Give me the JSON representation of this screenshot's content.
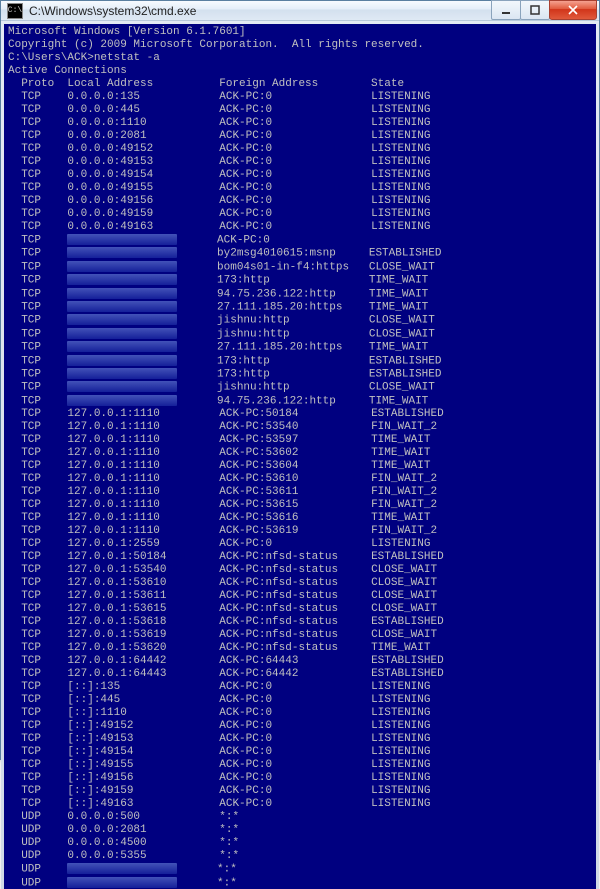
{
  "titlebar": {
    "icon_label": "C:\\",
    "title": "C:\\Windows\\system32\\cmd.exe"
  },
  "win_buttons": {
    "minimize_label": "minimize",
    "maximize_label": "maximize",
    "close_label": "close"
  },
  "console": {
    "line_version": "Microsoft Windows [Version 6.1.7601]",
    "line_copyright": "Copyright (c) 2009 Microsoft Corporation.  All rights reserved.",
    "prompt": "C:\\Users\\ACK>netstat -a",
    "section": "Active Connections",
    "columns": {
      "proto": "Proto",
      "local": "Local Address",
      "foreign": "Foreign Address",
      "state": "State"
    },
    "rows": [
      {
        "proto": "TCP",
        "local": "0.0.0.0:135",
        "foreign": "ACK-PC:0",
        "state": "LISTENING"
      },
      {
        "proto": "TCP",
        "local": "0.0.0.0:445",
        "foreign": "ACK-PC:0",
        "state": "LISTENING"
      },
      {
        "proto": "TCP",
        "local": "0.0.0.0:1110",
        "foreign": "ACK-PC:0",
        "state": "LISTENING"
      },
      {
        "proto": "TCP",
        "local": "0.0.0.0:2081",
        "foreign": "ACK-PC:0",
        "state": "LISTENING"
      },
      {
        "proto": "TCP",
        "local": "0.0.0.0:49152",
        "foreign": "ACK-PC:0",
        "state": "LISTENING"
      },
      {
        "proto": "TCP",
        "local": "0.0.0.0:49153",
        "foreign": "ACK-PC:0",
        "state": "LISTENING"
      },
      {
        "proto": "TCP",
        "local": "0.0.0.0:49154",
        "foreign": "ACK-PC:0",
        "state": "LISTENING"
      },
      {
        "proto": "TCP",
        "local": "0.0.0.0:49155",
        "foreign": "ACK-PC:0",
        "state": "LISTENING"
      },
      {
        "proto": "TCP",
        "local": "0.0.0.0:49156",
        "foreign": "ACK-PC:0",
        "state": "LISTENING"
      },
      {
        "proto": "TCP",
        "local": "0.0.0.0:49159",
        "foreign": "ACK-PC:0",
        "state": "LISTENING"
      },
      {
        "proto": "TCP",
        "local": "0.0.0.0:49163",
        "foreign": "ACK-PC:0",
        "state": "LISTENING"
      },
      {
        "proto": "TCP",
        "local": "[redacted]",
        "foreign": "ACK-PC:0",
        "state": ""
      },
      {
        "proto": "TCP",
        "local": "[redacted]",
        "foreign": "by2msg4010615:msnp",
        "state": "ESTABLISHED"
      },
      {
        "proto": "TCP",
        "local": "[redacted]",
        "foreign": "bom04s01-in-f4:https",
        "state": "CLOSE_WAIT"
      },
      {
        "proto": "TCP",
        "local": "[redacted]",
        "foreign": "173:http",
        "state": "TIME_WAIT"
      },
      {
        "proto": "TCP",
        "local": "[redacted]",
        "foreign": "94.75.236.122:http",
        "state": "TIME_WAIT"
      },
      {
        "proto": "TCP",
        "local": "[redacted]",
        "foreign": "27.111.185.20:https",
        "state": "TIME_WAIT"
      },
      {
        "proto": "TCP",
        "local": "[redacted]",
        "foreign": "jishnu:http",
        "state": "CLOSE_WAIT"
      },
      {
        "proto": "TCP",
        "local": "[redacted]",
        "foreign": "jishnu:http",
        "state": "CLOSE_WAIT"
      },
      {
        "proto": "TCP",
        "local": "[redacted]",
        "foreign": "27.111.185.20:https",
        "state": "TIME_WAIT"
      },
      {
        "proto": "TCP",
        "local": "[redacted]",
        "foreign": "173:http",
        "state": "ESTABLISHED"
      },
      {
        "proto": "TCP",
        "local": "[redacted]",
        "foreign": "173:http",
        "state": "ESTABLISHED"
      },
      {
        "proto": "TCP",
        "local": "[redacted]",
        "foreign": "jishnu:http",
        "state": "CLOSE_WAIT"
      },
      {
        "proto": "TCP",
        "local": "[redacted]",
        "foreign": "94.75.236.122:http",
        "state": "TIME_WAIT"
      },
      {
        "proto": "TCP",
        "local": "127.0.0.1:1110",
        "foreign": "ACK-PC:50184",
        "state": "ESTABLISHED"
      },
      {
        "proto": "TCP",
        "local": "127.0.0.1:1110",
        "foreign": "ACK-PC:53540",
        "state": "FIN_WAIT_2"
      },
      {
        "proto": "TCP",
        "local": "127.0.0.1:1110",
        "foreign": "ACK-PC:53597",
        "state": "TIME_WAIT"
      },
      {
        "proto": "TCP",
        "local": "127.0.0.1:1110",
        "foreign": "ACK-PC:53602",
        "state": "TIME_WAIT"
      },
      {
        "proto": "TCP",
        "local": "127.0.0.1:1110",
        "foreign": "ACK-PC:53604",
        "state": "TIME_WAIT"
      },
      {
        "proto": "TCP",
        "local": "127.0.0.1:1110",
        "foreign": "ACK-PC:53610",
        "state": "FIN_WAIT_2"
      },
      {
        "proto": "TCP",
        "local": "127.0.0.1:1110",
        "foreign": "ACK-PC:53611",
        "state": "FIN_WAIT_2"
      },
      {
        "proto": "TCP",
        "local": "127.0.0.1:1110",
        "foreign": "ACK-PC:53615",
        "state": "FIN_WAIT_2"
      },
      {
        "proto": "TCP",
        "local": "127.0.0.1:1110",
        "foreign": "ACK-PC:53616",
        "state": "TIME_WAIT"
      },
      {
        "proto": "TCP",
        "local": "127.0.0.1:1110",
        "foreign": "ACK-PC:53619",
        "state": "FIN_WAIT_2"
      },
      {
        "proto": "TCP",
        "local": "127.0.0.1:2559",
        "foreign": "ACK-PC:0",
        "state": "LISTENING"
      },
      {
        "proto": "TCP",
        "local": "127.0.0.1:50184",
        "foreign": "ACK-PC:nfsd-status",
        "state": "ESTABLISHED"
      },
      {
        "proto": "TCP",
        "local": "127.0.0.1:53540",
        "foreign": "ACK-PC:nfsd-status",
        "state": "CLOSE_WAIT"
      },
      {
        "proto": "TCP",
        "local": "127.0.0.1:53610",
        "foreign": "ACK-PC:nfsd-status",
        "state": "CLOSE_WAIT"
      },
      {
        "proto": "TCP",
        "local": "127.0.0.1:53611",
        "foreign": "ACK-PC:nfsd-status",
        "state": "CLOSE_WAIT"
      },
      {
        "proto": "TCP",
        "local": "127.0.0.1:53615",
        "foreign": "ACK-PC:nfsd-status",
        "state": "CLOSE_WAIT"
      },
      {
        "proto": "TCP",
        "local": "127.0.0.1:53618",
        "foreign": "ACK-PC:nfsd-status",
        "state": "ESTABLISHED"
      },
      {
        "proto": "TCP",
        "local": "127.0.0.1:53619",
        "foreign": "ACK-PC:nfsd-status",
        "state": "CLOSE_WAIT"
      },
      {
        "proto": "TCP",
        "local": "127.0.0.1:53620",
        "foreign": "ACK-PC:nfsd-status",
        "state": "TIME_WAIT"
      },
      {
        "proto": "TCP",
        "local": "127.0.0.1:64442",
        "foreign": "ACK-PC:64443",
        "state": "ESTABLISHED"
      },
      {
        "proto": "TCP",
        "local": "127.0.0.1:64443",
        "foreign": "ACK-PC:64442",
        "state": "ESTABLISHED"
      },
      {
        "proto": "TCP",
        "local": "[::]:135",
        "foreign": "ACK-PC:0",
        "state": "LISTENING"
      },
      {
        "proto": "TCP",
        "local": "[::]:445",
        "foreign": "ACK-PC:0",
        "state": "LISTENING"
      },
      {
        "proto": "TCP",
        "local": "[::]:1110",
        "foreign": "ACK-PC:0",
        "state": "LISTENING"
      },
      {
        "proto": "TCP",
        "local": "[::]:49152",
        "foreign": "ACK-PC:0",
        "state": "LISTENING"
      },
      {
        "proto": "TCP",
        "local": "[::]:49153",
        "foreign": "ACK-PC:0",
        "state": "LISTENING"
      },
      {
        "proto": "TCP",
        "local": "[::]:49154",
        "foreign": "ACK-PC:0",
        "state": "LISTENING"
      },
      {
        "proto": "TCP",
        "local": "[::]:49155",
        "foreign": "ACK-PC:0",
        "state": "LISTENING"
      },
      {
        "proto": "TCP",
        "local": "[::]:49156",
        "foreign": "ACK-PC:0",
        "state": "LISTENING"
      },
      {
        "proto": "TCP",
        "local": "[::]:49159",
        "foreign": "ACK-PC:0",
        "state": "LISTENING"
      },
      {
        "proto": "TCP",
        "local": "[::]:49163",
        "foreign": "ACK-PC:0",
        "state": "LISTENING"
      },
      {
        "proto": "UDP",
        "local": "0.0.0.0:500",
        "foreign": "*:*",
        "state": ""
      },
      {
        "proto": "UDP",
        "local": "0.0.0.0:2081",
        "foreign": "*:*",
        "state": ""
      },
      {
        "proto": "UDP",
        "local": "0.0.0.0:4500",
        "foreign": "*:*",
        "state": ""
      },
      {
        "proto": "UDP",
        "local": "0.0.0.0:5355",
        "foreign": "*:*",
        "state": ""
      },
      {
        "proto": "UDP",
        "local": "[redacted]",
        "foreign": "*:*",
        "state": ""
      },
      {
        "proto": "UDP",
        "local": "[redacted]",
        "foreign": "*:*",
        "state": ""
      }
    ]
  }
}
